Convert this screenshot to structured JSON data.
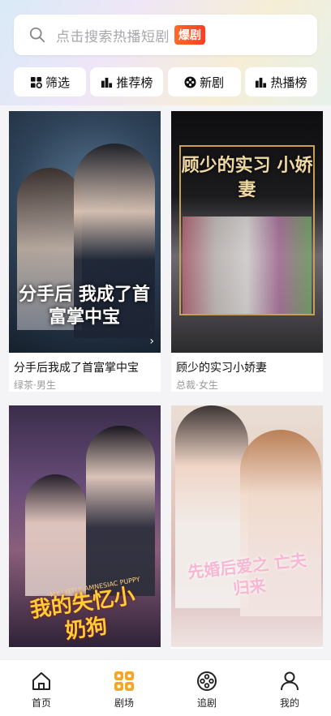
{
  "search": {
    "placeholder": "点击搜索热播短剧",
    "badge": "爆剧"
  },
  "filters": [
    {
      "label": "筛选",
      "icon": "filter-grid-icon"
    },
    {
      "label": "推荐榜",
      "icon": "rank-bars-icon"
    },
    {
      "label": "新剧",
      "icon": "new-circle-icon"
    },
    {
      "label": "热播榜",
      "icon": "hot-bars-icon"
    }
  ],
  "dramas": [
    {
      "title": "分手后我成了首富掌中宝",
      "tags": "绿茶·男生",
      "poster_text": "分手后 我成了首富掌中宝"
    },
    {
      "title": "顾少的实习小娇妻",
      "tags": "总裁·女生",
      "poster_text": "顾少的实习 小娇妻"
    },
    {
      "title": "",
      "tags": "",
      "poster_text": "我的失忆小奶狗",
      "poster_subtext": "MY LITTLE AMNESIAC PUPPY"
    },
    {
      "title": "",
      "tags": "",
      "poster_text": "先婚后爱之 亡夫归来"
    }
  ],
  "tabbar": [
    {
      "label": "首页",
      "icon": "home-icon",
      "active": false
    },
    {
      "label": "剧场",
      "icon": "theater-grid-icon",
      "active": true
    },
    {
      "label": "追剧",
      "icon": "film-reel-icon",
      "active": false
    },
    {
      "label": "我的",
      "icon": "user-icon",
      "active": false
    }
  ],
  "colors": {
    "accent": "#f5a623",
    "hot_badge": "#ff4a1f"
  }
}
